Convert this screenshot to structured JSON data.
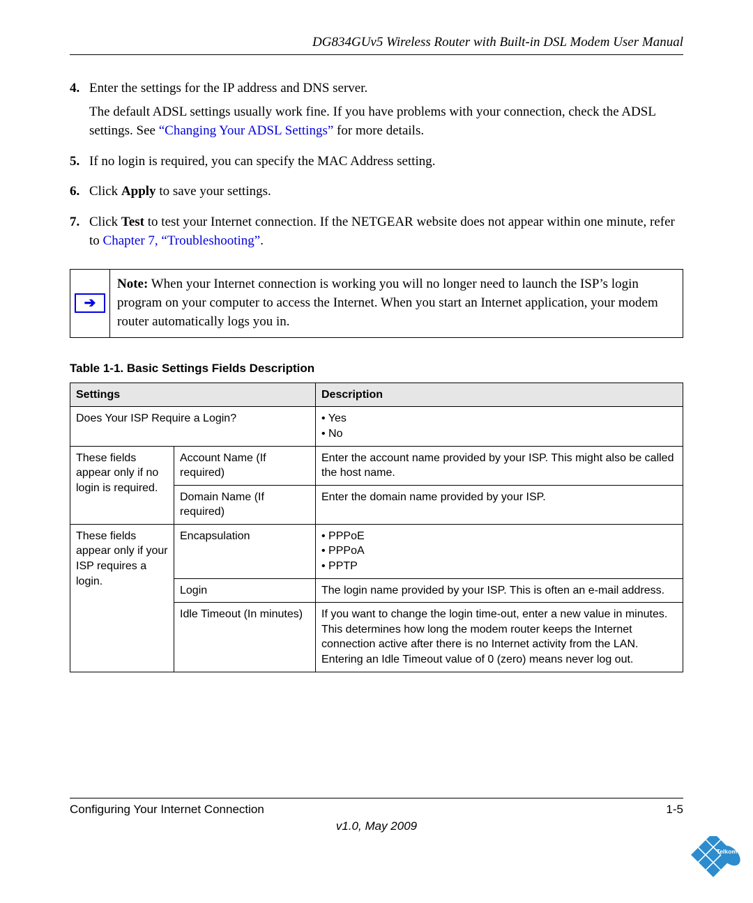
{
  "header": {
    "title": "DG834GUv5 Wireless Router with Built-in DSL Modem User Manual"
  },
  "steps": [
    {
      "num": "4.",
      "lines": [
        {
          "text": "Enter the settings for the IP address and DNS server."
        },
        {
          "prefix": "The default ADSL settings usually work fine. If you have problems with your connection, check the ADSL settings. See ",
          "link": "“Changing Your ADSL Settings”",
          "suffix": " for more details."
        }
      ]
    },
    {
      "num": "5.",
      "lines": [
        {
          "text": "If no login is required, you can specify the MAC Address setting."
        }
      ]
    },
    {
      "num": "6.",
      "lines": [
        {
          "prefix": "Click ",
          "bold": "Apply",
          "suffix": " to save your settings."
        }
      ]
    },
    {
      "num": "7.",
      "lines": [
        {
          "prefix": "Click ",
          "bold": "Test",
          "suffix": " to test your Internet connection. If the NETGEAR website does not appear within one minute, refer to ",
          "link": "Chapter 7, “Troubleshooting”",
          "suffix2": "."
        }
      ]
    }
  ],
  "note": {
    "label": "Note:",
    "text": " When your Internet connection is working you will no longer need to launch the ISP’s login program on your computer to access the Internet. When you start an Internet application, your modem router automatically logs you in.",
    "icon_glyph": "➔"
  },
  "table": {
    "caption": "Table 1-1.  Basic Settings Fields Description",
    "head": {
      "settings": "Settings",
      "description": "Description"
    },
    "rows": {
      "r1_setting": "Does Your ISP Require a Login?",
      "r1_desc": "• Yes\n• No",
      "g1_label": "These fields appear only if no login is required.",
      "g1a_field": "Account Name (If required)",
      "g1a_desc": "Enter the account name provided by your ISP. This might also be called the host name.",
      "g1b_field": "Domain Name (If required)",
      "g1b_desc": "Enter the domain name provided by your ISP.",
      "g2_label": "These fields appear only if your ISP requires a login.",
      "g2a_field": "Encapsulation",
      "g2a_desc": "• PPPoE\n• PPPoA\n• PPTP",
      "g2b_field": "Login",
      "g2b_desc": "The login name provided by your ISP. This is often an e-mail address.",
      "g2c_field": "Idle Timeout (In minutes)",
      "g2c_desc": "If you want to change the login time-out, enter a new value in minutes. This determines how long the modem router keeps the Internet connection active after there is no Internet activity from the LAN. Entering an Idle Timeout value of 0 (zero) means never log out."
    }
  },
  "footer": {
    "section": "Configuring Your Internet Connection",
    "page": "1-5",
    "version": "v1.0, May 2009"
  },
  "logo": {
    "brand": "Telkom"
  }
}
